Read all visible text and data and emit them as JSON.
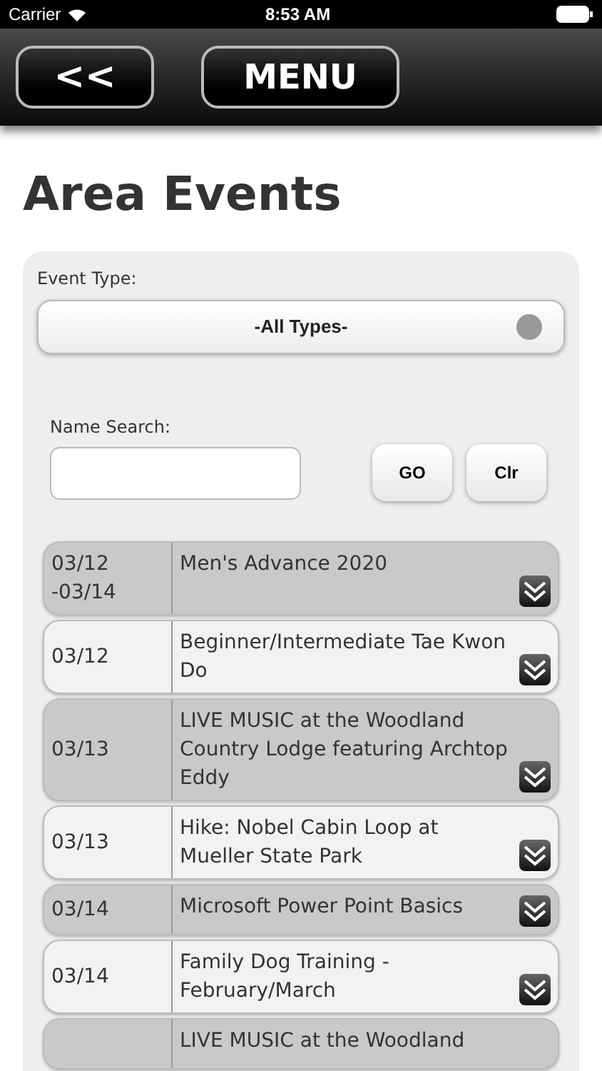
{
  "status_bar": {
    "carrier": "Carrier",
    "time": "8:53 AM"
  },
  "header": {
    "back_button": "<<",
    "menu_button": "MENU"
  },
  "title": "Area Events",
  "filters": {
    "event_type_label": "Event Type:",
    "event_type_value": "-All Types-",
    "name_search_label": "Name Search:",
    "go_button": "GO",
    "clear_button": "Clr"
  },
  "events": [
    {
      "date": "03/12 -03/14",
      "name": "Men's Advance 2020"
    },
    {
      "date": "03/12",
      "name": "Beginner/Intermediate Tae Kwon Do"
    },
    {
      "date": "03/13",
      "name": "LIVE MUSIC at the Woodland Country Lodge featuring Archtop Eddy"
    },
    {
      "date": "03/13",
      "name": "Hike: Nobel Cabin Loop at Mueller State Park"
    },
    {
      "date": "03/14",
      "name": "Microsoft Power Point Basics"
    },
    {
      "date": "03/14",
      "name": "Family Dog Training - February/March"
    },
    {
      "name": "LIVE MUSIC at the Woodland"
    }
  ]
}
